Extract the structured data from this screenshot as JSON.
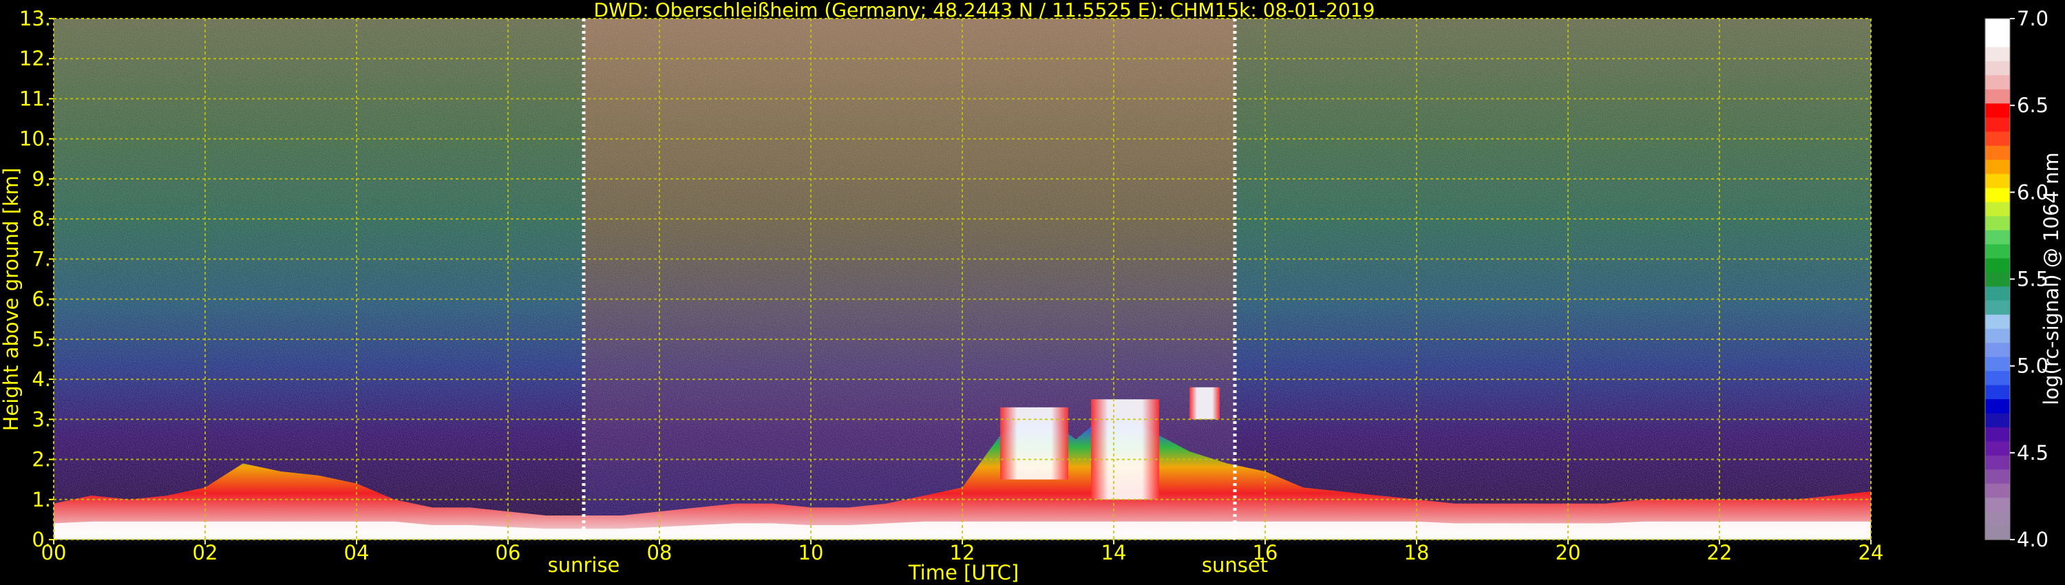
{
  "colors": {
    "background": "#000000",
    "text": "#ffff00",
    "grid": "#c8c800",
    "colorbar_text": "#ffffff",
    "event_line": "#ffffff"
  },
  "chart_data": {
    "type": "heatmap",
    "title": "DWD: Oberschleißheim (Germany; 48.2443 N / 11.5525 E):    CHM15k: 08-01-2019",
    "xlabel": "Time [UTC]",
    "ylabel": "Height above ground [km]",
    "xlim": [
      0,
      24
    ],
    "ylim": [
      0,
      13
    ],
    "x_ticks": [
      0,
      2,
      4,
      6,
      8,
      10,
      12,
      14,
      16,
      18,
      20,
      22,
      24
    ],
    "x_tick_labels": [
      "00",
      "02",
      "04",
      "06",
      "08",
      "10",
      "12",
      "14",
      "16",
      "18",
      "20",
      "22",
      "24"
    ],
    "y_ticks": [
      0,
      1,
      2,
      3,
      4,
      5,
      6,
      7,
      8,
      9,
      10,
      11,
      12,
      13
    ],
    "y_tick_labels": [
      "0.",
      "1.",
      "2.",
      "3.",
      "4.",
      "5.",
      "6.",
      "7.",
      "8.",
      "9.",
      "10.",
      "11.",
      "12.",
      "13."
    ],
    "grid": true,
    "events": [
      {
        "label": "sunrise",
        "time": 7.0
      },
      {
        "label": "sunset",
        "time": 15.6
      }
    ],
    "colorbar": {
      "label": "log(rc-signal) @ 1064 nm",
      "range": [
        4.0,
        7.0
      ],
      "ticks": [
        4.0,
        4.5,
        5.0,
        5.5,
        6.0,
        6.5,
        7.0
      ],
      "tick_labels": [
        "4.0",
        "4.5",
        "5.0",
        "5.5",
        "6.0",
        "6.5",
        "7.0"
      ],
      "colors": [
        "#9a8aa6",
        "#a088ac",
        "#a584b2",
        "#9c6aaa",
        "#8a4fa8",
        "#7a32a8",
        "#6a1aa8",
        "#5210a8",
        "#1a10b0",
        "#0000cd",
        "#1e3ce6",
        "#3c64f0",
        "#5a82f0",
        "#7896f0",
        "#8caff0",
        "#a0c8f0",
        "#46aaa0",
        "#32a08c",
        "#1e9632",
        "#14a028",
        "#32be46",
        "#5ad264",
        "#96e64b",
        "#c8f032",
        "#ffff00",
        "#ffd200",
        "#ffa500",
        "#ff7814",
        "#ff461e",
        "#ff1e14",
        "#ff0000",
        "#f08c8c",
        "#f0b4b4",
        "#f0d2d2",
        "#f5e6e6",
        "#ffffff",
        "#ffffff"
      ]
    },
    "boundary_layer_profile": {
      "t": [
        0,
        0.5,
        1,
        1.5,
        2,
        2.5,
        3,
        3.5,
        4,
        4.5,
        5,
        5.5,
        6,
        6.5,
        7,
        7.5,
        8,
        8.5,
        9,
        9.5,
        10,
        10.5,
        11,
        11.5,
        12,
        12.5,
        13,
        13.5,
        14,
        14.5,
        15,
        15.5,
        16,
        16.5,
        17,
        17.5,
        18,
        18.5,
        19,
        19.5,
        20,
        20.5,
        21,
        21.5,
        22,
        22.5,
        23,
        23.5,
        24
      ],
      "top_km": [
        0.9,
        1.1,
        1.0,
        1.1,
        1.3,
        1.9,
        1.7,
        1.6,
        1.4,
        1.0,
        0.8,
        0.8,
        0.7,
        0.6,
        0.6,
        0.6,
        0.7,
        0.8,
        0.9,
        0.9,
        0.8,
        0.8,
        0.9,
        1.1,
        1.3,
        2.6,
        3.2,
        2.5,
        3.3,
        2.7,
        2.2,
        1.9,
        1.7,
        1.3,
        1.2,
        1.1,
        1.0,
        0.9,
        0.9,
        0.9,
        0.9,
        0.9,
        1.0,
        1.0,
        1.0,
        1.0,
        1.0,
        1.1,
        1.2
      ]
    },
    "cloud_layers": [
      {
        "t_start": 12.5,
        "t_end": 13.4,
        "base_km": 1.5,
        "top_km": 3.3
      },
      {
        "t_start": 13.7,
        "t_end": 14.6,
        "base_km": 1.0,
        "top_km": 3.5
      },
      {
        "t_start": 15.0,
        "t_end": 15.4,
        "base_km": 3.0,
        "top_km": 3.8
      }
    ]
  }
}
